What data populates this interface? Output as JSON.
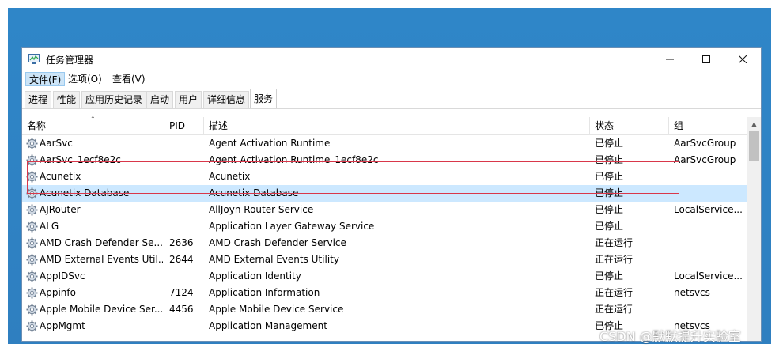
{
  "window": {
    "title": "任务管理器"
  },
  "menubar": [
    {
      "label": "文件(F)",
      "active": true
    },
    {
      "label": "选项(O)",
      "active": false
    },
    {
      "label": "查看(V)",
      "active": false
    }
  ],
  "tabs": [
    {
      "label": "进程",
      "selected": false
    },
    {
      "label": "性能",
      "selected": false
    },
    {
      "label": "应用历史记录",
      "selected": false
    },
    {
      "label": "启动",
      "selected": false
    },
    {
      "label": "用户",
      "selected": false
    },
    {
      "label": "详细信息",
      "selected": false
    },
    {
      "label": "服务",
      "selected": true
    }
  ],
  "columns": {
    "name": "名称",
    "pid": "PID",
    "desc": "描述",
    "status": "状态",
    "group": "组"
  },
  "services": [
    {
      "name": "AarSvc",
      "pid": "",
      "desc": "Agent Activation Runtime",
      "status": "已停止",
      "group": "AarSvcGroup"
    },
    {
      "name": "AarSvc_1ecf8e2c",
      "pid": "",
      "desc": "Agent Activation Runtime_1ecf8e2c",
      "status": "已停止",
      "group": "AarSvcGroup"
    },
    {
      "name": "Acunetix",
      "pid": "",
      "desc": "Acunetix",
      "status": "已停止",
      "group": ""
    },
    {
      "name": "Acunetix Database",
      "pid": "",
      "desc": "Acunetix Database",
      "status": "已停止",
      "group": "",
      "selected": true
    },
    {
      "name": "AJRouter",
      "pid": "",
      "desc": "AllJoyn Router Service",
      "status": "已停止",
      "group": "LocalService..."
    },
    {
      "name": "ALG",
      "pid": "",
      "desc": "Application Layer Gateway Service",
      "status": "已停止",
      "group": ""
    },
    {
      "name": "AMD Crash Defender Se...",
      "pid": "2636",
      "desc": "AMD Crash Defender Service",
      "status": "正在运行",
      "group": ""
    },
    {
      "name": "AMD External Events Util...",
      "pid": "2644",
      "desc": "AMD External Events Utility",
      "status": "正在运行",
      "group": ""
    },
    {
      "name": "AppIDSvc",
      "pid": "",
      "desc": "Application Identity",
      "status": "已停止",
      "group": "LocalService..."
    },
    {
      "name": "Appinfo",
      "pid": "7124",
      "desc": "Application Information",
      "status": "正在运行",
      "group": "netsvcs"
    },
    {
      "name": "Apple Mobile Device Ser...",
      "pid": "4456",
      "desc": "Apple Mobile Device Service",
      "status": "正在运行",
      "group": ""
    },
    {
      "name": "AppMgmt",
      "pid": "",
      "desc": "Application Management",
      "status": "已停止",
      "group": "netsvcs"
    }
  ],
  "watermark": "CSDN @默默提升实验室",
  "colors": {
    "selected_row": "#cce8ff",
    "callout_border": "#d9374a",
    "desktop": "#2f86c8"
  }
}
